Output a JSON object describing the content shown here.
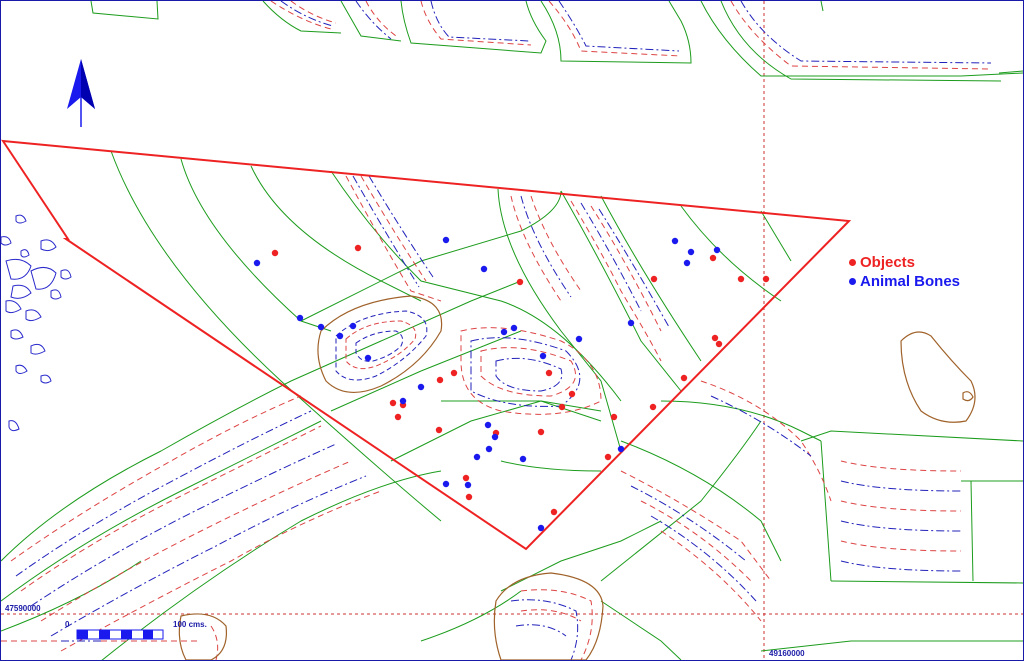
{
  "legend": {
    "objects_label": "Objects",
    "bones_label": "Animal Bones"
  },
  "coords": {
    "y_label": "47590000",
    "x_label": "49160000"
  },
  "scale": {
    "zero_label": "0",
    "end_label": "100 cms."
  },
  "colors": {
    "excavation_outline": "#ee2222",
    "objects": "#ee2222",
    "animal_bones": "#1a1aee",
    "contour_green": "#1c9c1c",
    "contour_brown": "#a0622a",
    "grid_line": "#cc3333",
    "north_arrow": "#1a1aee"
  },
  "icons": {
    "north_arrow": "north-arrow-icon"
  }
}
